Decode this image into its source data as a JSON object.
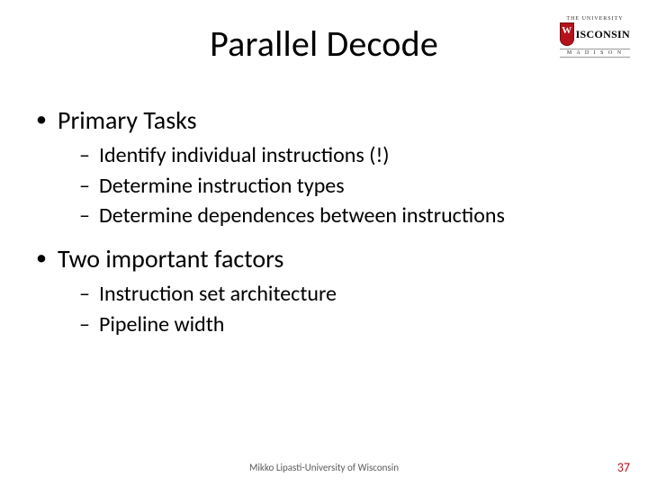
{
  "title": "Parallel Decode",
  "logo": {
    "line_top": "THE UNIVERSITY",
    "wordmark": "ISCONSIN",
    "line_bottom": "M A D I S O N"
  },
  "bullets": {
    "b1": {
      "label": "Primary Tasks",
      "sub": {
        "s1": "Identify individual instructions (!)",
        "s2": "Determine instruction types",
        "s3": "Determine dependences between instructions"
      }
    },
    "b2": {
      "label": "Two important factors",
      "sub": {
        "s1": "Instruction set architecture",
        "s2": "Pipeline width"
      }
    }
  },
  "footer": {
    "credit": "Mikko Lipasti-University of Wisconsin",
    "page": "37"
  }
}
